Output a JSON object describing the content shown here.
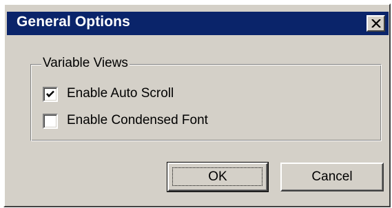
{
  "window": {
    "title": "General Options"
  },
  "group": {
    "label": "Variable Views",
    "options": [
      {
        "label": "Enable Auto Scroll",
        "checked": true
      },
      {
        "label": "Enable Condensed Font",
        "checked": false
      }
    ]
  },
  "buttons": {
    "ok_label": "OK",
    "cancel_label": "Cancel"
  },
  "colors": {
    "titlebar": "#0a246a",
    "face": "#d4d0c8"
  },
  "icons": {
    "close": "close-icon",
    "check": "checkmark-icon"
  }
}
